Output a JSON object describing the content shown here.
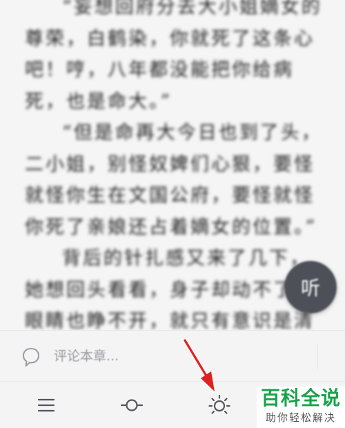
{
  "reader": {
    "paragraphs": [
      "“妄想回府分去大小姐嫡女的尊荣，白鹤染，你就死了这条心吧！哼，八年都没能把你给病死，也是命大。”",
      "“但是命再大今日也到了头，二小姐，别怪奴婢们心狠，要怪就怪你生在文国公府，要怪就怪你死了亲娘还占着嫡女的位置。”",
      "背后的针扎感又来了几下，她想回头看看，身子却动不了，眼睛也睁不开，就只有意识是清醒的。那两个"
    ],
    "listen_button": "听"
  },
  "comment": {
    "placeholder": "评论本章..."
  },
  "toolbar": {
    "items": [
      {
        "icon": "menu-icon"
      },
      {
        "icon": "progress-icon"
      },
      {
        "icon": "brightness-icon"
      }
    ]
  },
  "watermark": {
    "title": "百科全说",
    "subtitle": "助你轻松解决"
  },
  "colors": {
    "background": "#f4f4f5",
    "text": "#1e1e1e",
    "fab": "#4d5058",
    "icon": "#55555c",
    "arrow": "#e02020",
    "watermark_green": "#17a34a"
  }
}
